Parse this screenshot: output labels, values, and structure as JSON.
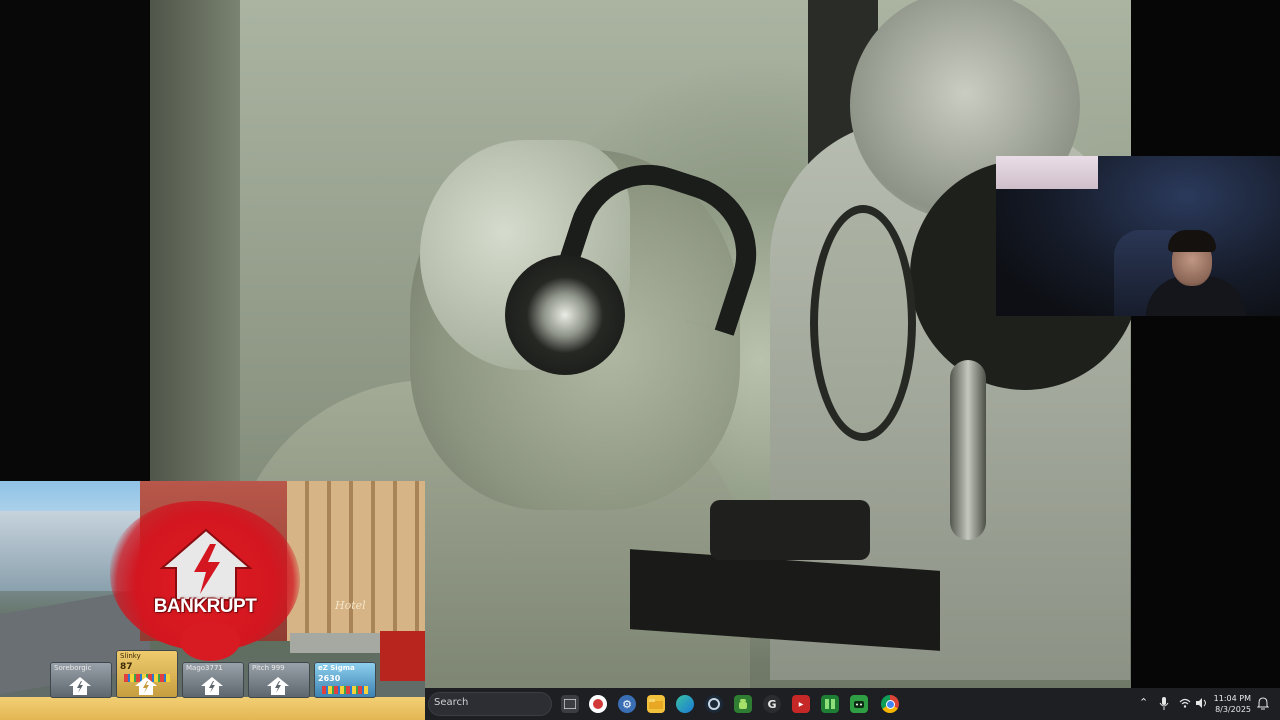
{
  "game": {
    "banner": "BANKRUPT",
    "hotel_sign": "Hotel",
    "players": [
      {
        "name": "Soreborgic",
        "score": ""
      },
      {
        "name": "Slinky",
        "score": "87"
      },
      {
        "name": "Mago3771",
        "score": ""
      },
      {
        "name": "Pitch 999",
        "score": ""
      },
      {
        "name": "eZ Sigma",
        "score": "2630"
      }
    ]
  },
  "taskbar": {
    "search_label": "Search",
    "apps": [
      "task-view",
      "chromium-app",
      "settings",
      "file-explorer",
      "edge",
      "steam",
      "android-app",
      "g-app",
      "video-editor",
      "spreadsheet",
      "green-app",
      "chrome"
    ],
    "clock_time": "11:04 PM",
    "clock_date": "8/3/2025"
  },
  "colors": {
    "taskbar_bg": "#1d1f23",
    "bankrupt_red": "#d31620",
    "gold_bar": "#e3b653"
  }
}
